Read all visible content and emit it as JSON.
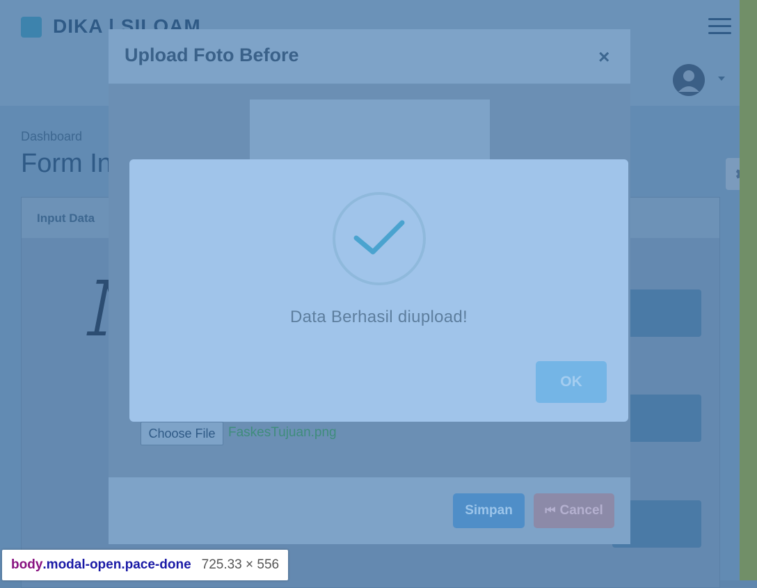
{
  "header": {
    "brand": "DIKA | SILOAM"
  },
  "breadcrumb": {
    "label": "Dashboard"
  },
  "page": {
    "title": "Form In"
  },
  "card": {
    "tab_label": "Input Data"
  },
  "upload_modal": {
    "title": "Upload Foto Before",
    "close_symbol": "×",
    "choose_file_label": "Choose File",
    "file_name": "FaskesTujuan.png",
    "save_label": "Simpan",
    "cancel_label": "Cancel"
  },
  "alert": {
    "message": "Data Berhasil diupload!",
    "ok_label": "OK"
  },
  "devtools_tooltip": {
    "tag": "body",
    "classes": ".modal-open.pace-done",
    "dimensions": "725.33 × 556"
  },
  "icons": [
    "hamburger-icon",
    "avatar",
    "caret-down-icon",
    "gear-icon",
    "close-icon",
    "checkmark-icon",
    "cancel-icon"
  ]
}
